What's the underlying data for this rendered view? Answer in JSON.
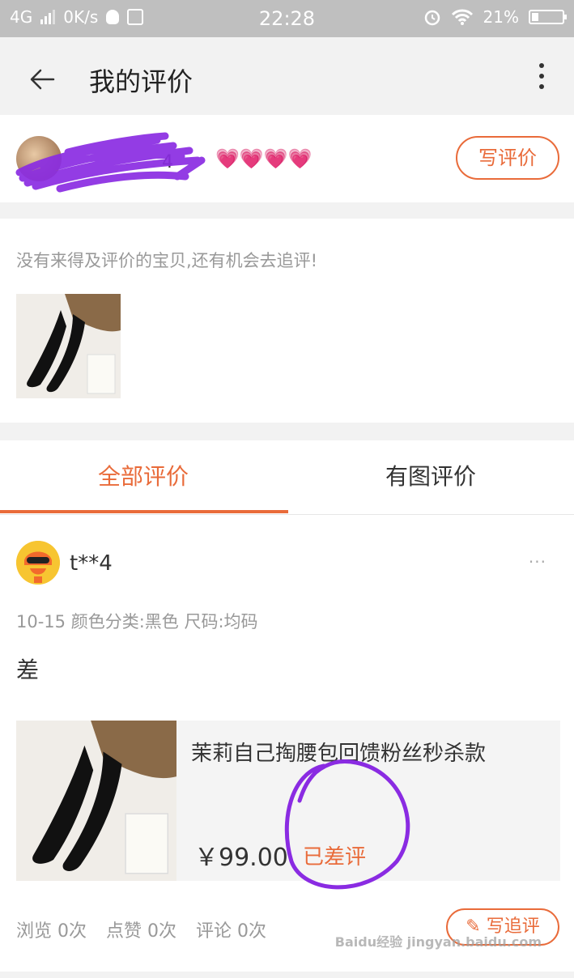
{
  "status_bar": {
    "network": "4G",
    "speed": "0K/s",
    "time": "22:28",
    "battery": "21%"
  },
  "header": {
    "title": "我的评价"
  },
  "user": {
    "name_fragment": "4",
    "hearts": "💗💗💗💗",
    "write_review_label": "写评价"
  },
  "pending": {
    "hint": "没有来得及评价的宝贝,还有机会去追评!"
  },
  "tabs": [
    {
      "label": "全部评价",
      "active": true
    },
    {
      "label": "有图评价",
      "active": false
    }
  ],
  "review": {
    "user_name": "t**4",
    "more": "···",
    "meta": "10-15  颜色分类:黑色  尺码:均码",
    "text": "差",
    "product": {
      "title": "茉莉自己掏腰包回馈粉丝秒杀款",
      "price": "￥99.00",
      "status": "已差评"
    },
    "stats": [
      "浏览 0次",
      "点赞 0次",
      "评论 0次"
    ],
    "followup_label": "写追评"
  },
  "watermark": "Baidu经验 jingyan.baidu.com",
  "colors": {
    "accent": "#e96b3a",
    "annotation": "#8a2be2"
  },
  "icons": [
    "signal-icon",
    "qq-icon",
    "sim-icon",
    "alarm-icon",
    "wifi-icon",
    "battery-icon",
    "back-arrow-icon",
    "more-vertical-icon",
    "more-horizontal-icon",
    "edit-icon"
  ]
}
